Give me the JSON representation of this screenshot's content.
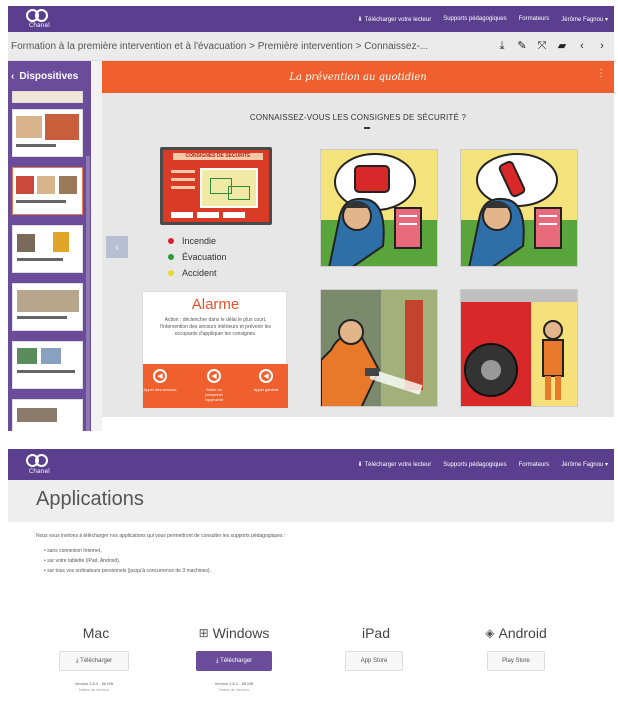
{
  "colors": {
    "purple": "#5b3f8f",
    "orange": "#f0602e"
  },
  "app": {
    "logo_text": "Chanel"
  },
  "topnav": {
    "download": "Télécharger votre lecteur",
    "supports": "Supports pédagogiques",
    "formateurs": "Formateurs",
    "user": "Jérôme Fagnou"
  },
  "breadcrumb": "Formation à la première intervention et à l'évacuation > Première intervention > Connaissez-...",
  "toolbar": {
    "icons": [
      "download-icon",
      "pen-icon",
      "expand-icon",
      "folder-icon",
      "prev-icon",
      "next-icon"
    ]
  },
  "sidebar": {
    "title": "Dispositives",
    "thumbs": [
      {
        "caption": "Organisation de la sécurité"
      },
      {
        "caption": "Consignes de sécurité"
      },
      {
        "caption": "Plan de quartier"
      },
      {
        "caption": "L'alarme"
      },
      {
        "caption": "Connaissance : les consignes"
      },
      {
        "caption": "Vidéo"
      }
    ]
  },
  "slide": {
    "banner": "La prévention au quotidien",
    "question": "CONNAISSEZ-VOUS LES CONSIGNES DE SÉCURITÉ ?",
    "card_header": "CONSIGNES DE SÉCURITÉ",
    "legend": [
      {
        "label": "Incendie",
        "color": "#d8202a"
      },
      {
        "label": "Évacuation",
        "color": "#2a9a3a"
      },
      {
        "label": "Accident",
        "color": "#e9d92a"
      }
    ],
    "alarm": {
      "title": "Alarme",
      "text": "Action : déclencher dans le délai le plus court, l'intervention des secours intérieurs et prévenir les occupants d'appliquer les consignes.",
      "steps": [
        {
          "label": "Appel des secours"
        },
        {
          "label": "Sortie du personnel rapproché"
        },
        {
          "label": "Appel général"
        }
      ]
    }
  },
  "apps": {
    "title": "Applications",
    "intro": "Nous vous invitons à télécharger nos applications qui vous permettront de consulter les supports pédagogiques :",
    "bullets": [
      "sans connexion Internet,",
      "sur votre tablette (iPad, Android),",
      "sur tous vos ordinateurs personnels (jusqu'à concurrence de 3 machines)."
    ],
    "platforms": [
      {
        "name": "Mac",
        "icon": "apple-icon",
        "button": "Télécharger",
        "version": "Version 1.8.4 - 88 MB",
        "notes": "Notes de version"
      },
      {
        "name": "Windows",
        "icon": "windows-icon",
        "button": "Télécharger",
        "version": "Version 1.8.1 - 88 MB",
        "notes": "Notes de version"
      },
      {
        "name": "iPad",
        "icon": "apple-icon",
        "button": "App Store",
        "version": "",
        "notes": ""
      },
      {
        "name": "Android",
        "icon": "android-icon",
        "button": "Play Store",
        "version": "",
        "notes": ""
      }
    ]
  }
}
